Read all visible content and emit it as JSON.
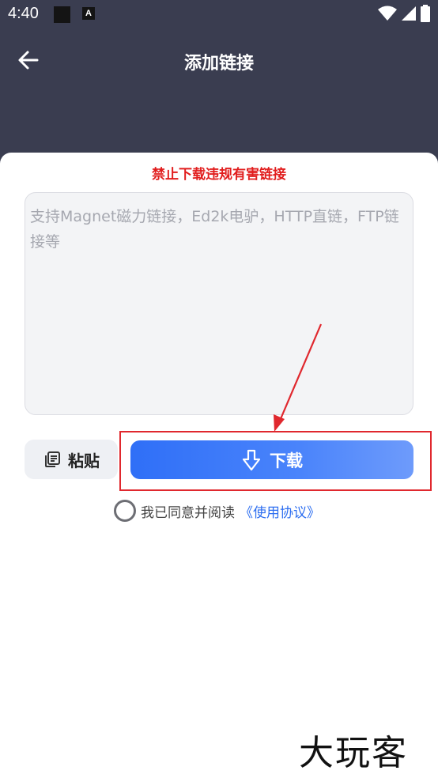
{
  "status_bar": {
    "time": "4:40",
    "notification_icon": "A"
  },
  "header": {
    "back_icon": "arrow-left-icon",
    "title": "添加链接"
  },
  "sheet": {
    "warning": "禁止下载违规有害链接",
    "link_input": {
      "value": "",
      "placeholder": "支持Magnet磁力链接，Ed2k电驴，HTTP直链，FTP链接等"
    },
    "paste_button": {
      "label": "粘贴",
      "icon": "clipboard-icon"
    },
    "download_button": {
      "label": "下载",
      "icon": "download-arrow-icon"
    },
    "agreement": {
      "prefix": "我已同意并阅读",
      "link": "《使用协议》",
      "checked": false
    }
  },
  "annotation": {
    "color": "#e0282e"
  },
  "watermark": "大玩客",
  "colors": {
    "header_bg": "#3a3d50",
    "accent_blue": "#2f6ff7",
    "warning_red": "#e11d1d"
  }
}
